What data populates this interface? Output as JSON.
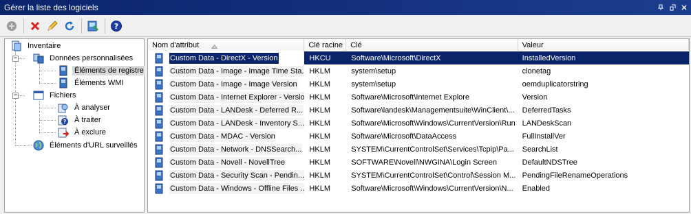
{
  "window": {
    "title": "Gérer la liste des logiciels"
  },
  "titlebar_buttons": [
    "pin",
    "float",
    "close"
  ],
  "toolbar": {
    "buttons": [
      "add-disabled",
      "delete",
      "edit",
      "refresh",
      "import",
      "help"
    ]
  },
  "tree": {
    "root": "Inventaire",
    "items": [
      {
        "label": "Données personnalisées",
        "icon": "computer-icon"
      },
      {
        "label": "Éléments de registre",
        "icon": "registry-icon",
        "selected": true
      },
      {
        "label": "Éléments WMI",
        "icon": "wmi-icon"
      },
      {
        "label": "Fichiers",
        "icon": "window-icon"
      },
      {
        "label": "À analyser",
        "icon": "scan-icon"
      },
      {
        "label": "À traiter",
        "icon": "question-icon"
      },
      {
        "label": "À exclure",
        "icon": "exclude-icon"
      },
      {
        "label": "Éléments d'URL surveillés",
        "icon": "globe-icon"
      }
    ]
  },
  "list": {
    "columns": [
      "Nom d'attribut",
      "Clé racine",
      "Clé",
      "Valeur"
    ],
    "rows": [
      [
        "Custom Data - DirectX - Version",
        "HKCU",
        "Software\\Microsoft\\DirectX",
        "InstalledVersion"
      ],
      [
        "Custom Data - Image - Image Time Sta...",
        "HKLM",
        "system\\setup",
        "clonetag"
      ],
      [
        "Custom Data - Image - Image Version",
        "HKLM",
        "system\\setup",
        "oemduplicatorstring"
      ],
      [
        "Custom Data - Internet Explorer - Version",
        "HKLM",
        "Software\\Microsoft\\Internet Explore",
        "Version"
      ],
      [
        "Custom Data - LANDesk - Deferred R...",
        "HKLM",
        "Software\\landesk\\Managementsuite\\WinClient\\...",
        "DeferredTasks"
      ],
      [
        "Custom Data - LANDesk - Inventory S...",
        "HKLM",
        "Software\\Microsoft\\Windows\\CurrentVersion\\Run",
        "LANDeskScan"
      ],
      [
        "Custom Data - MDAC - Version",
        "HKLM",
        "Software\\Microsoft\\DataAccess",
        "FullInstallVer"
      ],
      [
        "Custom Data - Network - DNSSearch...",
        "HKLM",
        "SYSTEM\\CurrentControlSet\\Services\\Tcpip\\Pa...",
        "SearchList"
      ],
      [
        "Custom Data - Novell - NovellTree",
        "HKLM",
        "SOFTWARE\\Novell\\NWGINA\\Login Screen",
        "DefaultNDSTree"
      ],
      [
        "Custom Data - Security Scan - Pendin...",
        "HKLM",
        "SYSTEM\\CurrentControlSet\\Control\\Session M...",
        "PendingFileRenameOperations"
      ],
      [
        "Custom Data - Windows - Offline Files ...",
        "HKLM",
        "Software\\Microsoft\\Windows\\CurrentVersion\\N...",
        "Enabled"
      ]
    ],
    "selected_row": 0
  },
  "colors": {
    "titlebar": "#0a246a",
    "selection": "#0a246a"
  }
}
